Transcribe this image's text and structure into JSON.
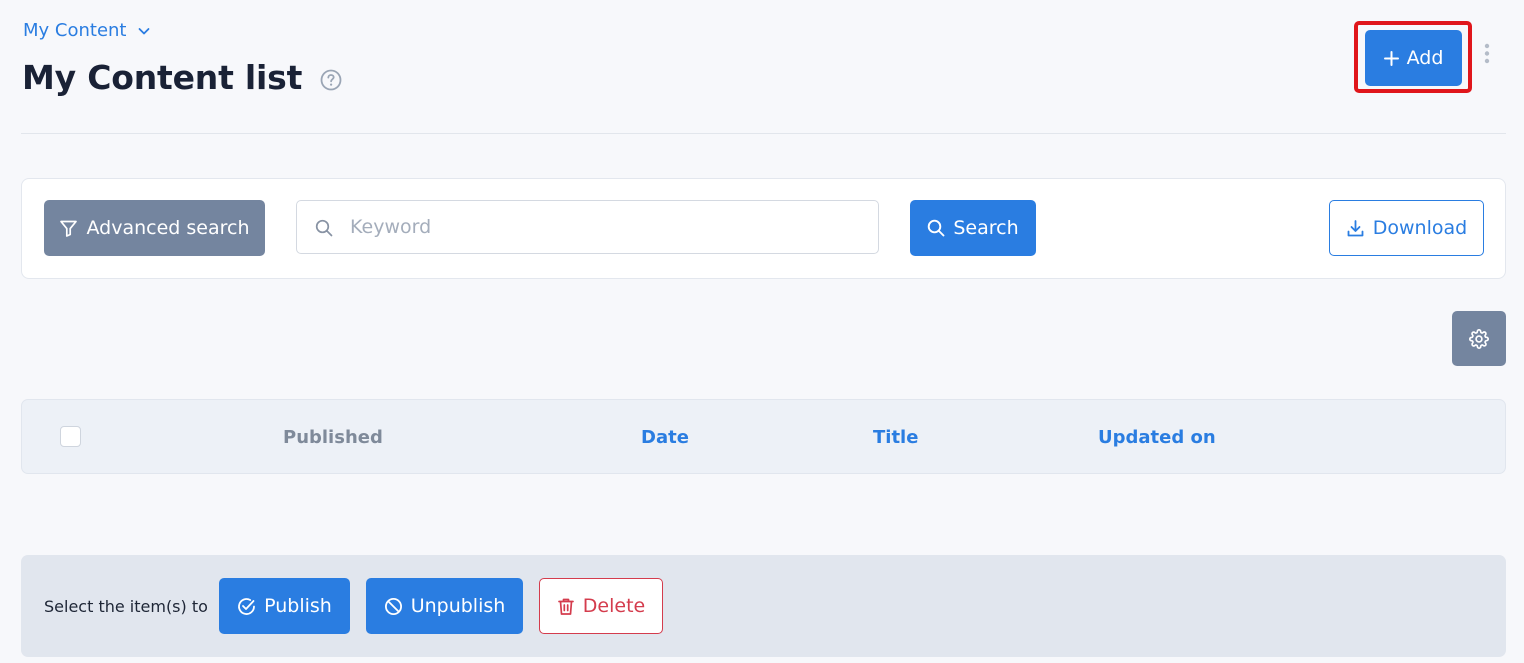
{
  "header": {
    "breadcrumb": "My Content",
    "title": "My Content list",
    "add_label": "Add"
  },
  "search": {
    "advanced_label": "Advanced search",
    "placeholder": "Keyword",
    "value": "",
    "search_label": "Search",
    "download_label": "Download"
  },
  "table": {
    "columns": [
      "Published",
      "Date",
      "Title",
      "Updated on"
    ]
  },
  "bulk": {
    "label": "Select the item(s) to",
    "publish_label": "Publish",
    "unpublish_label": "Unpublish",
    "delete_label": "Delete"
  },
  "colors": {
    "accent": "#2a7de1",
    "secondary": "#74859f",
    "danger": "#d43c4d",
    "highlight": "#e0161b"
  },
  "icons": [
    "chevron-down-icon",
    "help-icon",
    "plus-icon",
    "more-vertical-icon",
    "filter-icon",
    "search-icon",
    "download-icon",
    "gear-icon",
    "check-circle-icon",
    "ban-icon",
    "trash-icon"
  ]
}
